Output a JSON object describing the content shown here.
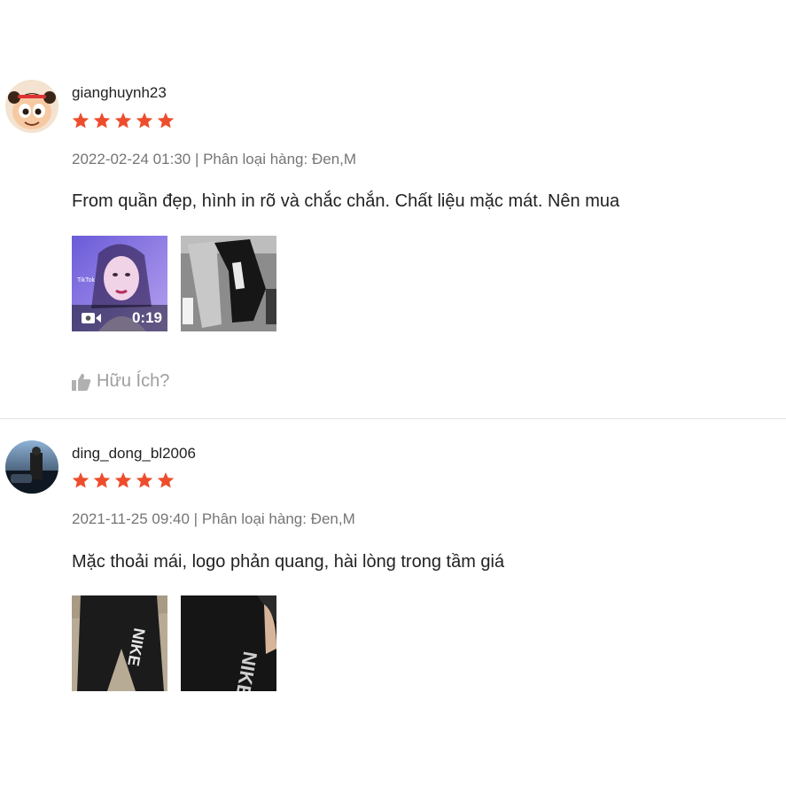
{
  "colors": {
    "star": "#ee4d2d",
    "meta": "#757575",
    "muted": "#9e9e9e"
  },
  "reviews": [
    {
      "username": "gianghuynh23",
      "rating": 5,
      "meta": "2022-02-24 01:30 | Phân loại hàng: Đen,M",
      "comment": "From quần đẹp, hình in rõ và chắc chắn. Chất liệu mặc mát. Nên mua",
      "video_duration": "0:19",
      "media_icons": [
        "video-camera-icon"
      ],
      "helpful_label": "Hữu Ích?"
    },
    {
      "username": "ding_dong_bl2006",
      "rating": 5,
      "meta": "2021-11-25 09:40 | Phân loại hàng: Đen,M",
      "comment": "Mặc thoải mái, logo phản quang, hài lòng trong tầm giá"
    }
  ]
}
